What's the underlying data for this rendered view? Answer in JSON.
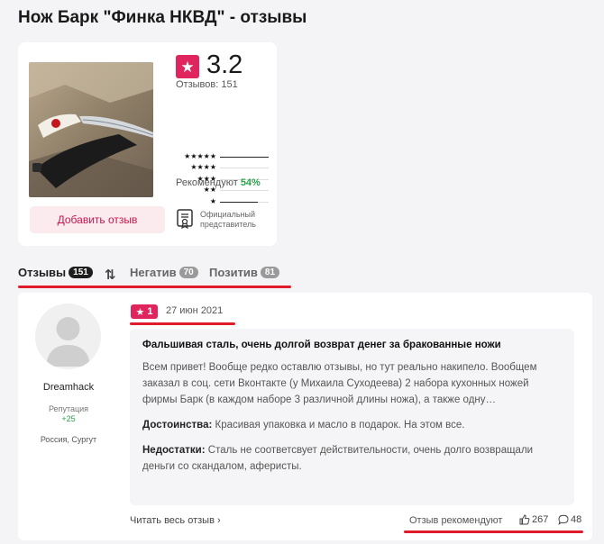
{
  "title": "Нож Барк \"Финка НКВД\" - отзывы",
  "product": {
    "rating": "3.2",
    "reviews_count": "Отзывов: 151",
    "distribution": [
      {
        "stars": "★★★★★",
        "fraction": 1.0
      },
      {
        "stars": "★★★★",
        "fraction": 0.0
      },
      {
        "stars": "★★★",
        "fraction": 0.0
      },
      {
        "stars": "★★",
        "fraction": 0.0
      },
      {
        "stars": "★",
        "fraction": 0.78
      }
    ],
    "recommend_label": "Рекомендуют",
    "recommend_value": "54%",
    "add_review": "Добавить отзыв",
    "official_line1": "Официальный",
    "official_line2": "представитель"
  },
  "tabs": {
    "reviews": {
      "label": "Отзывы",
      "count": "151"
    },
    "negative": {
      "label": "Негатив",
      "count": "70"
    },
    "positive": {
      "label": "Позитив",
      "count": "81"
    }
  },
  "review": {
    "author": "Dreamhack",
    "reputation_label": "Репутация",
    "reputation_value": "+25",
    "location": "Россия, Сургут",
    "score": "1",
    "date": "27 июн 2021",
    "title": "Фальшивая сталь, очень долгой возврат денег за бракованные ножи",
    "text": "Всем привет! Вообще редко оставлю отзывы, но тут реально накипело. Вообщем заказал в соц. сети Вконтакте (у Михаила Суходеева) 2 набора кухонных ножей фирмы Барк (в каждом наборе 3 различной длины ножа), а также одну…",
    "pros_label": "Достоинства:",
    "pros": "Красивая упаковка и масло в подарок. На этом все.",
    "cons_label": "Недостатки:",
    "cons": "Сталь не соответсвует действительности, очень долго возвращали деньги со скандалом, аферисты.",
    "read_more": "Читать весь отзыв",
    "recommend_label": "Отзыв рекомендуют",
    "likes": "267",
    "comments": "48"
  },
  "colors": {
    "accent": "#e0245e",
    "underline": "#e01b2b",
    "positive": "#2ba24c"
  }
}
